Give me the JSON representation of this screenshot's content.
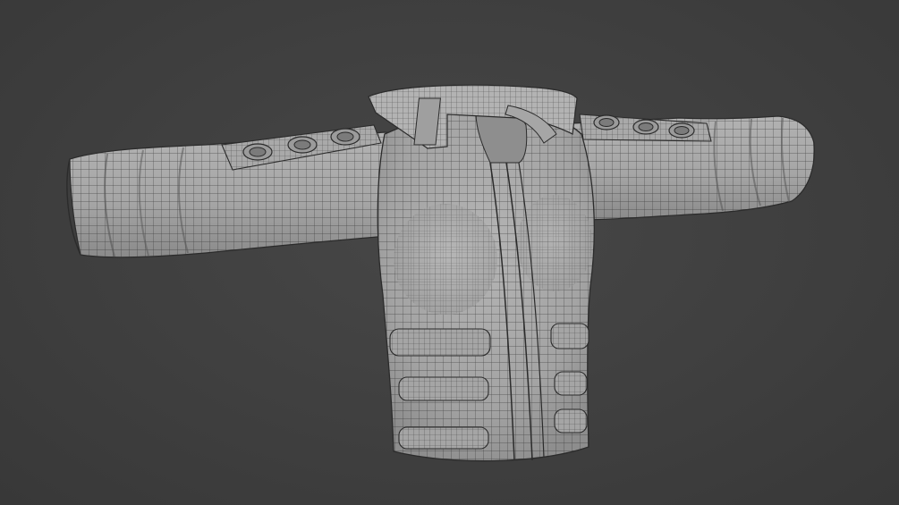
{
  "scene": {
    "background_color": "#3d3d3d",
    "mesh_base_color": "#a9a9a9",
    "wire_color": "#2a2a2a",
    "object": "jacket-mesh-wireframe"
  }
}
